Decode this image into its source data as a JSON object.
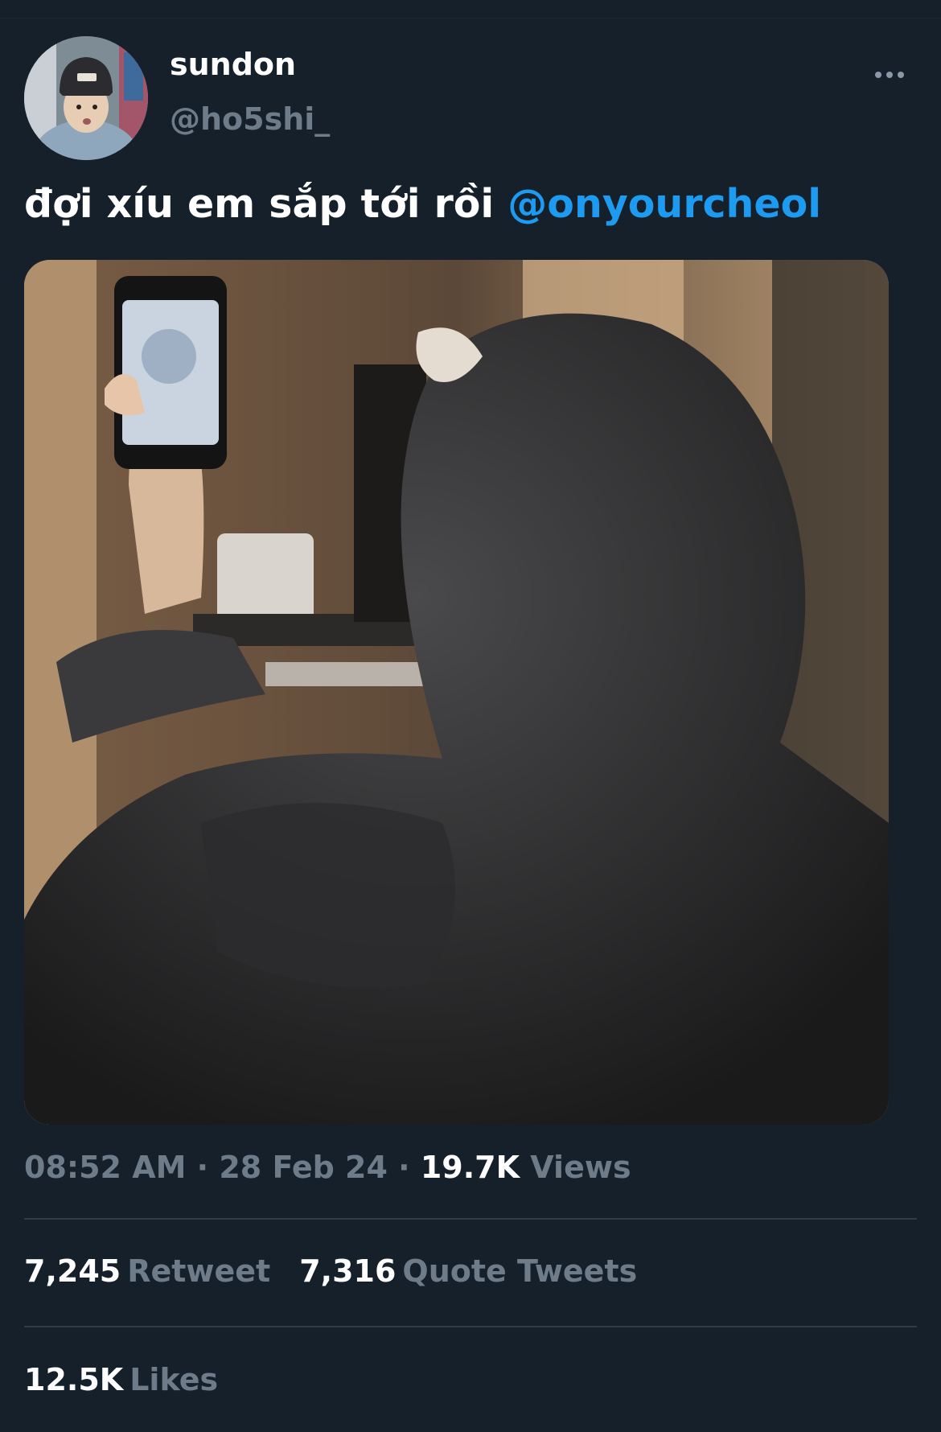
{
  "author": {
    "display_name": "sundon",
    "handle": "@ho5shi_"
  },
  "tweet": {
    "text": "đợi xíu em sắp tới rồi ",
    "mention": "@onyourcheol"
  },
  "meta": {
    "time": "08:52 AM",
    "separator_1": " · ",
    "date": "28 Feb 24",
    "separator_2": " · ",
    "views_count": "19.7K",
    "views_label": "Views"
  },
  "stats": {
    "retweets_count": "7,245",
    "retweets_label": "Retweet",
    "quotes_count": "7,316",
    "quotes_label": "Quote Tweets",
    "likes_count": "12.5K",
    "likes_label": "Likes"
  },
  "icons": {
    "more": "more-horizontal-icon"
  },
  "colors": {
    "background": "#15202b",
    "mention": "#1d9bf0",
    "secondary_text": "#6e7c89",
    "divider": "#2f3b47"
  }
}
